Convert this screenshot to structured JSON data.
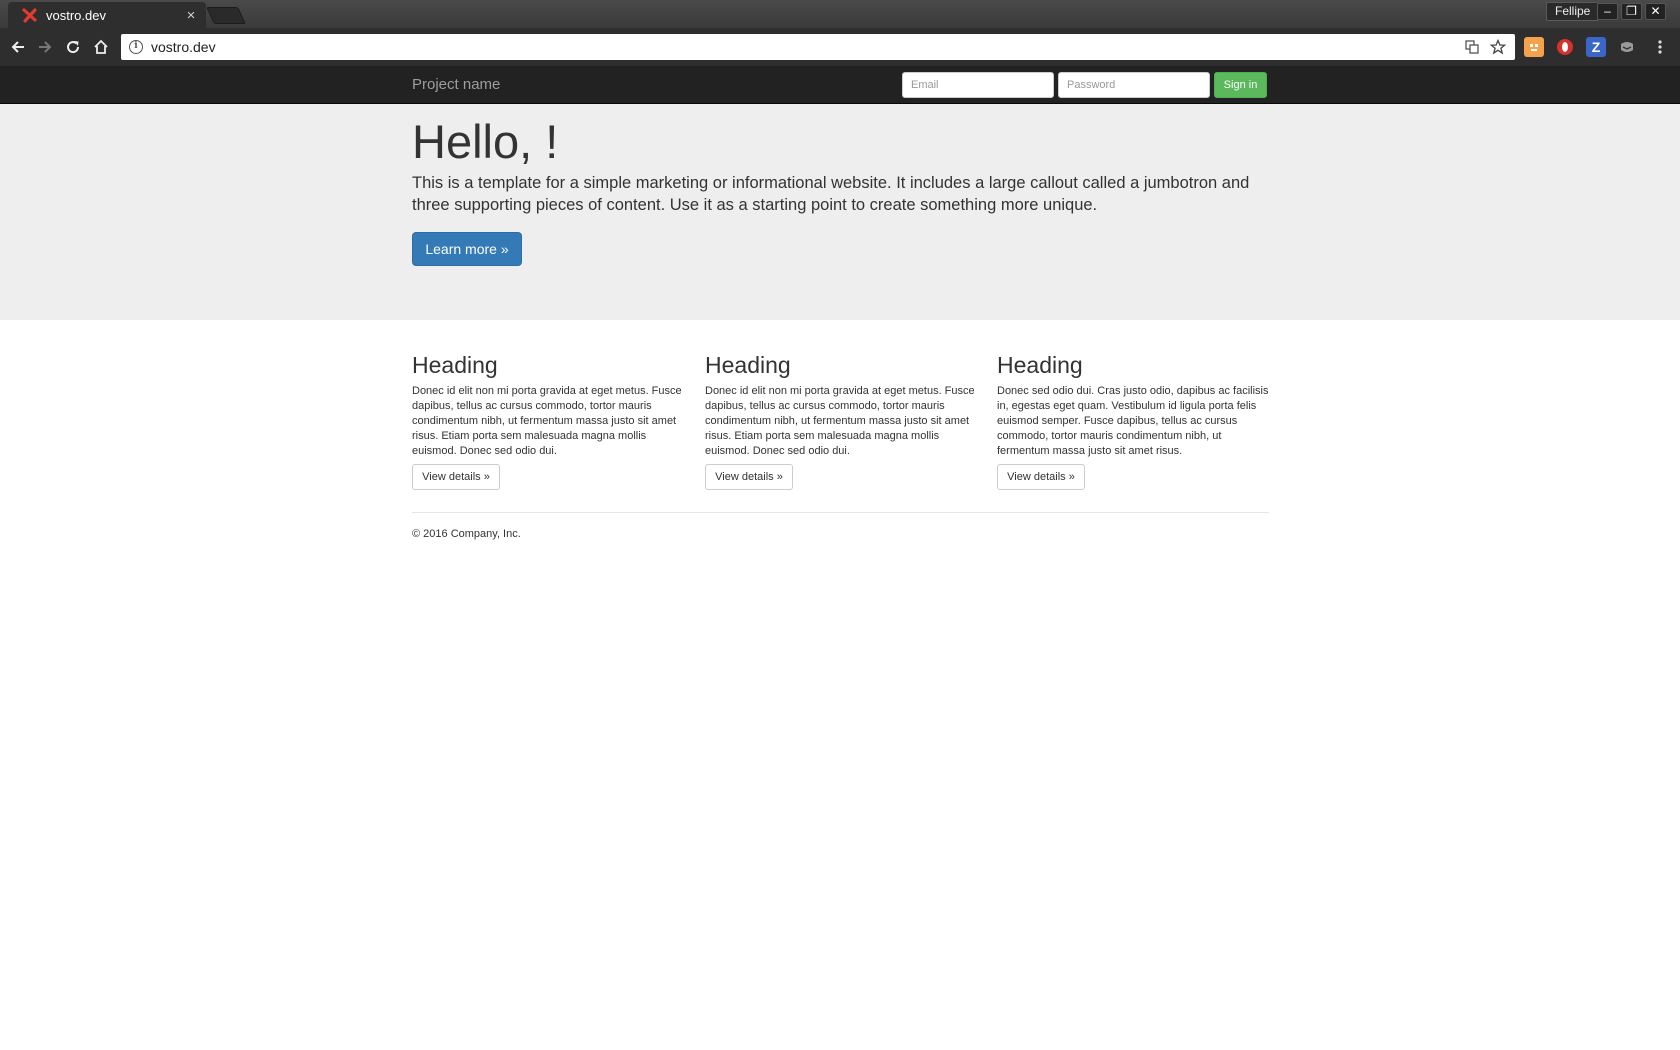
{
  "browser": {
    "tab_title": "vostro.dev",
    "tab_close": "×",
    "profile_name": "Fellipe",
    "url": "vostro.dev",
    "window_controls": {
      "minimize": "–",
      "restore": "❐",
      "close": "✕"
    },
    "extension_colors": [
      "#f4a34c",
      "#d9302c",
      "#3a66c7",
      "#9a9a9a"
    ]
  },
  "navbar": {
    "brand": "Project name",
    "email_placeholder": "Email",
    "password_placeholder": "Password",
    "signin_label": "Sign in"
  },
  "jumbotron": {
    "title": "Hello, !",
    "lead": "This is a template for a simple marketing or informational website. It includes a large callout called a jumbotron and three supporting pieces of content. Use it as a starting point to create something more unique.",
    "button_label": "Learn more »"
  },
  "columns": [
    {
      "heading": "Heading",
      "text": "Donec id elit non mi porta gravida at eget metus. Fusce dapibus, tellus ac cursus commodo, tortor mauris condimentum nibh, ut fermentum massa justo sit amet risus. Etiam porta sem malesuada magna mollis euismod. Donec sed odio dui.",
      "button_label": "View details »"
    },
    {
      "heading": "Heading",
      "text": "Donec id elit non mi porta gravida at eget metus. Fusce dapibus, tellus ac cursus commodo, tortor mauris condimentum nibh, ut fermentum massa justo sit amet risus. Etiam porta sem malesuada magna mollis euismod. Donec sed odio dui.",
      "button_label": "View details »"
    },
    {
      "heading": "Heading",
      "text": "Donec sed odio dui. Cras justo odio, dapibus ac facilisis in, egestas eget quam. Vestibulum id ligula porta felis euismod semper. Fusce dapibus, tellus ac cursus commodo, tortor mauris condimentum nibh, ut fermentum massa justo sit amet risus.",
      "button_label": "View details »"
    }
  ],
  "footer": {
    "copyright": "© 2016 Company, Inc."
  },
  "theme": {
    "navbar_bg": "#222222",
    "jumbotron_bg": "#eeeeee",
    "primary": "#337ab7",
    "success": "#5cb85c"
  }
}
